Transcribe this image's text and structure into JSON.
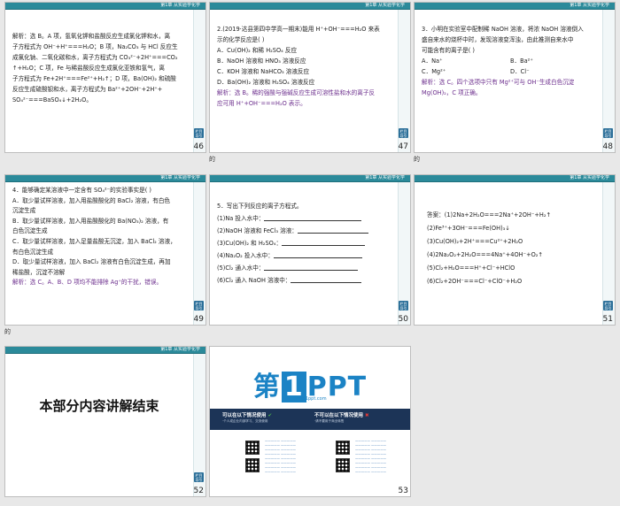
{
  "chapter_header": "第1章  从实验学化学",
  "nav_button": "栏目导引",
  "slides": [
    {
      "page": "46",
      "lines": [
        "解析：选 B。A 项，氢氧化钾和盐酸反应生成氯化钾和水，离",
        "子方程式为 OH⁻+H⁺===H₂O；B 项，Na₂CO₃ 与 HCl 反应生",
        "成氯化钠、二氧化碳和水，离子方程式为 CO₃²⁻+2H⁺===CO₂",
        "↑+H₂O；C 项，Fe 与稀盐酸反应生成氯化亚铁和氢气，离",
        "子方程式为 Fe+2H⁺===Fe²⁺+H₂↑；D 项，Ba(OH)₂ 和硫酸",
        "反应生成硫酸钡和水，离子方程式为 Ba²⁺+2OH⁻+2H⁺+",
        "SO₄²⁻===BaSO₄↓+2H₂O。"
      ]
    },
    {
      "page": "47",
      "question": [
        "2.(2019·达县第四中学高一期末)能用 H⁺+OH⁻===H₂O 来表",
        "示的化学反应是(      )"
      ],
      "options": [
        "A．Cu(OH)₂ 和稀 H₂SO₄ 反应",
        "B．NaOH 溶液和 HNO₃ 溶液反应",
        "C．KOH 溶液和 NaHCO₃ 溶液反应",
        "D．Ba(OH)₂ 溶液和 H₂SO₄ 溶液反应"
      ],
      "answer": [
        "解析：选 B。稀的强酸与强碱反应生成可溶性盐和水的离子反",
        "应可用 H⁺+OH⁻===H₂O 表示。"
      ]
    },
    {
      "page": "48",
      "question": [
        "3．小明在实验室中配制稀 NaOH 溶液，将浓 NaOH 溶液倒入",
        "盛自来水的烧杯中时，发现溶液变浑浊，由此推测自来水中",
        "可能含有的离子是(      )"
      ],
      "options_row1": [
        "A．Na⁺",
        "B．Ba²⁺"
      ],
      "options_row2": [
        "C．Mg²⁺",
        "D．Cl⁻"
      ],
      "answer": [
        "解析：选 C。四个选项中只有 Mg²⁺可与 OH⁻生成白色沉淀",
        "Mg(OH)₂，C 项正确。"
      ]
    },
    {
      "page": "49",
      "question": [
        "4．能够确定某溶液中一定含有 SO₄²⁻的实验事实是(      )"
      ],
      "options": [
        "A．取少量试样溶液，加入用盐酸酸化的 BaCl₂ 溶液，有白色",
        "沉淀生成",
        "B．取少量试样溶液，加入用盐酸酸化的 Ba(NO₃)₂ 溶液，有",
        "白色沉淀生成",
        "C．取少量试样溶液，加入足量盐酸无沉淀，加入 BaCl₂ 溶液，",
        "有白色沉淀生成",
        "D．取少量试样溶液，加入 BaCl₂ 溶液有白色沉淀生成，再加",
        "稀盐酸，沉淀不溶解"
      ],
      "answer": [
        "解析：选 C。A、B、D 项均不能排除 Ag⁺的干扰，错误。"
      ]
    },
    {
      "page": "50",
      "title": "5．写出下列反应的离子方程式。",
      "items": [
        "(1)Na 投入水中：",
        "(2)NaOH 溶液和 FeCl₃ 溶液：",
        "(3)Cu(OH)₂ 和 H₂SO₄：",
        "(4)Na₂O₂ 投入水中：",
        "(5)Cl₂ 通入水中：",
        "(6)Cl₂ 通入 NaOH 溶液中："
      ]
    },
    {
      "page": "51",
      "answers": [
        "答案：(1)2Na+2H₂O===2Na⁺+2OH⁻+H₂↑",
        "(2)Fe³⁺+3OH⁻===Fe(OH)₃↓",
        "(3)Cu(OH)₂+2H⁺===Cu²⁺+2H₂O",
        "(4)2Na₂O₂+2H₂O===4Na⁺+4OH⁻+O₂↑",
        "(5)Cl₂+H₂O===H⁺+Cl⁻+HClO",
        "(6)Cl₂+2OH⁻===Cl⁻+ClO⁻+H₂O"
      ]
    },
    {
      "page": "52",
      "title": "本部分内容讲解结束"
    },
    {
      "page": "53",
      "logo_prefix": "第",
      "logo_num": "1",
      "logo_suffix": "PPT",
      "logo_url": "www.1ppt.com",
      "can_use_title": "可以在以下情况使用",
      "cannot_use_title": "不可以在以下情况使用",
      "can_use_note": "·个人或企业内部学习、交流使用",
      "cannot_use_note": "·请不要用于商业转售"
    }
  ],
  "edge_marks": [
    "的",
    "的",
    "的"
  ]
}
